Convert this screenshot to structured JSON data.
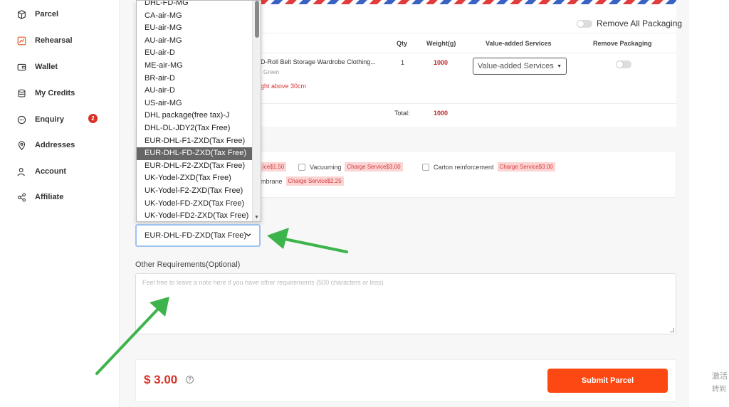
{
  "sidebar": {
    "items": [
      {
        "label": "Parcel",
        "icon": "box-icon"
      },
      {
        "label": "Rehearsal",
        "icon": "chart-icon"
      },
      {
        "label": "Wallet",
        "icon": "wallet-icon"
      },
      {
        "label": "My Credits",
        "icon": "database-icon"
      },
      {
        "label": "Enquiry",
        "icon": "chat-icon",
        "badge": "2"
      },
      {
        "label": "Addresses",
        "icon": "location-pin-icon"
      },
      {
        "label": "Account",
        "icon": "user-icon"
      },
      {
        "label": "Affiliate",
        "icon": "share-icon"
      }
    ]
  },
  "packaging": {
    "remove_all_label": "Remove All Packaging"
  },
  "table": {
    "headers": {
      "qty": "Qty",
      "weight": "Weight(g)",
      "vas": "Value-added Services",
      "remove": "Remove Packaging"
    },
    "row": {
      "name": "D-Roll Belt Storage Wardrobe Clothing...",
      "variant": "Green",
      "note": "ght above 30cm",
      "qty": "1",
      "weight": "1000",
      "vas_placeholder": "Value-added Services"
    },
    "total_label": "Total:",
    "total_weight": "1000"
  },
  "services": [
    {
      "label": "",
      "charge": "ice$1.50"
    },
    {
      "label": "Vacuuming",
      "charge": "Charge Service$3.00"
    },
    {
      "label": "Carton reinforcement",
      "charge": "Charge Service$3.00"
    },
    {
      "label": "mbrane",
      "charge": "Charge Service$2.25"
    }
  ],
  "shipping": {
    "options": [
      "DHL-FD-MG",
      "CA-air-MG",
      "EU-air-MG",
      "AU-air-MG",
      "EU-air-D",
      "ME-air-MG",
      "BR-air-D",
      "AU-air-D",
      "US-air-MG",
      "DHL package(free tax)-J",
      "DHL-DL-JDY2(Tax Free)",
      "EUR-DHL-F1-ZXD(Tax Free)",
      "EUR-DHL-FD-ZXD(Tax Free)",
      "EUR-DHL-F2-ZXD(Tax Free)",
      "UK-Yodel-ZXD(Tax Free)",
      "UK-Yodel-F2-ZXD(Tax Free)",
      "UK-Yodel-FD-ZXD(Tax Free)",
      "UK-Yodel-FD2-ZXD(Tax Free)"
    ],
    "selected_index": 12,
    "selected": "EUR-DHL-FD-ZXD(Tax Free)"
  },
  "requirements": {
    "label": "Other Requirements(Optional)",
    "placeholder": "Feel free to leave a note here if you have other requirements (500 characters or less)"
  },
  "footer": {
    "price": "$ 3.00",
    "help": "?",
    "submit_label": "Submit Parcel"
  },
  "watermark": {
    "line1": "激活",
    "line2": "转到"
  },
  "colors": {
    "accent": "#fc4813",
    "annotation_arrow": "#3cb44b",
    "price": "#d8332a"
  }
}
